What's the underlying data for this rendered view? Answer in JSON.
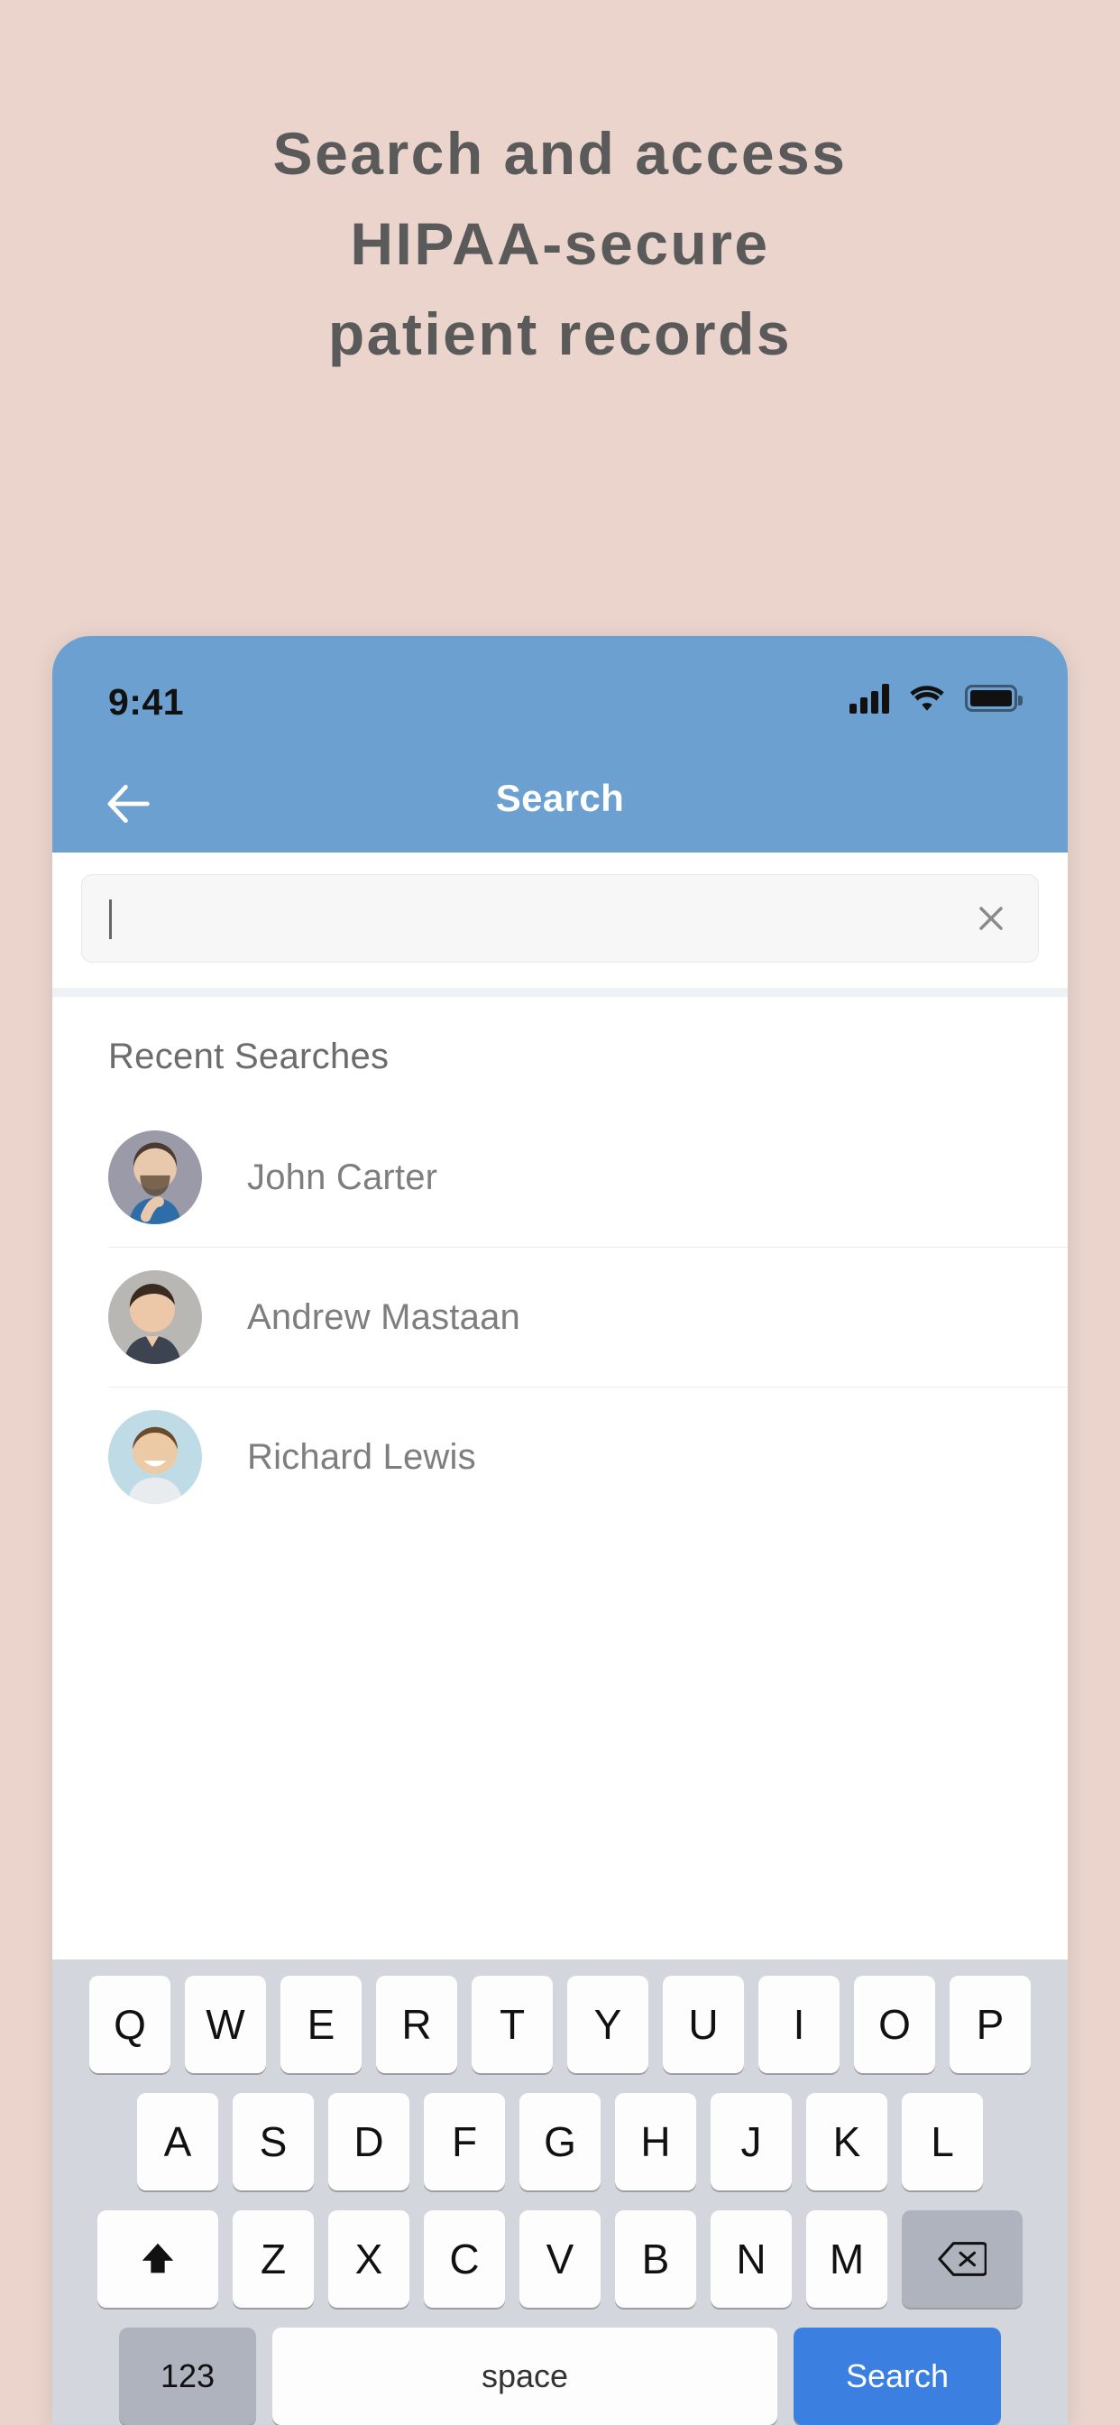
{
  "promo": {
    "lines": [
      "Search and access",
      "HIPAA-secure",
      "patient records"
    ],
    "background_color": "#ead4cc",
    "text_color": "#5a5a5a"
  },
  "phone": {
    "status_bar": {
      "time": "9:41",
      "icons": [
        "cellular-signal-icon",
        "wifi-icon",
        "battery-icon"
      ],
      "background_color": "#6ba0d0"
    },
    "nav_bar": {
      "back_icon": "arrow-left-icon",
      "title": "Search",
      "background_color": "#6ba0d0",
      "title_color": "#ffffff"
    },
    "search": {
      "value": "",
      "placeholder": "",
      "clear_icon": "close-x-icon"
    },
    "recent": {
      "section_title": "Recent Searches",
      "items": [
        {
          "name": "John Carter",
          "avatar": "avatar-john-carter"
        },
        {
          "name": "Andrew Mastaan",
          "avatar": "avatar-andrew-mastaan"
        },
        {
          "name": "Richard Lewis",
          "avatar": "avatar-richard-lewis"
        }
      ]
    },
    "keyboard": {
      "row1": [
        "Q",
        "W",
        "E",
        "R",
        "T",
        "Y",
        "U",
        "I",
        "O",
        "P"
      ],
      "row2": [
        "A",
        "S",
        "D",
        "F",
        "G",
        "H",
        "J",
        "K",
        "L"
      ],
      "row3": [
        "Z",
        "X",
        "C",
        "V",
        "B",
        "N",
        "M"
      ],
      "shift_icon": "shift-arrow-up-icon",
      "backspace_icon": "backspace-delete-icon",
      "numbers_label": "123",
      "space_label": "space",
      "action_label": "Search",
      "action_color": "#3b7fe0"
    }
  }
}
